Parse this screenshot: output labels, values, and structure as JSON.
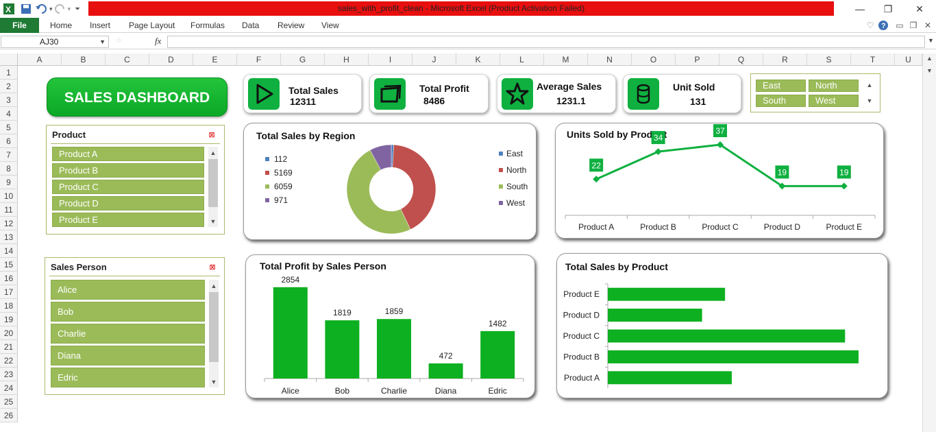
{
  "window": {
    "title": "sales_with_profit_clean  -  Microsoft Excel (Product Activation Failed)"
  },
  "ribbon": {
    "file": "File",
    "tabs": [
      "Home",
      "Insert",
      "Page Layout",
      "Formulas",
      "Data",
      "Review",
      "View"
    ]
  },
  "formula_bar": {
    "name_box": "AJ30",
    "fx_label": "fx",
    "formula": ""
  },
  "columns": [
    "A",
    "B",
    "C",
    "D",
    "E",
    "F",
    "G",
    "H",
    "I",
    "J",
    "K",
    "L",
    "M",
    "N",
    "O",
    "P",
    "Q",
    "R",
    "S",
    "T",
    "U"
  ],
  "rows": [
    "1",
    "2",
    "3",
    "4",
    "5",
    "6",
    "7",
    "8",
    "9",
    "10",
    "11",
    "12",
    "13",
    "14",
    "15",
    "16",
    "17",
    "18",
    "19",
    "20",
    "21",
    "22",
    "23",
    "24",
    "25",
    "26"
  ],
  "dashboard": {
    "title": "SALES DASHBOARD",
    "kpis": [
      {
        "label": "Total Sales",
        "value": "12311",
        "icon": "play-icon"
      },
      {
        "label": "Total Profit",
        "value": "8486",
        "icon": "folder-icon"
      },
      {
        "label": "Average Sales",
        "value": "1231.1",
        "icon": "star-icon"
      },
      {
        "label": "Unit Sold",
        "value": "131",
        "icon": "database-icon"
      }
    ],
    "region_slicer": {
      "items": [
        "East",
        "North",
        "South",
        "West"
      ]
    },
    "product_slicer": {
      "title": "Product",
      "items": [
        "Product A",
        "Product B",
        "Product C",
        "Product D",
        "Product E"
      ]
    },
    "salesperson_slicer": {
      "title": "Sales Person",
      "items": [
        "Alice",
        "Bob",
        "Charlie",
        "Diana",
        "Edric"
      ]
    }
  },
  "colors": {
    "accent_green": "#0fb040",
    "slicer_green": "#9bbb59",
    "east": "#4f81bd",
    "north": "#c0504d",
    "south": "#9bbb59",
    "west": "#8064a2",
    "bar_green": "#0db020"
  },
  "chart_data": [
    {
      "type": "pie",
      "title": "Total Sales by Region",
      "categories": [
        "East",
        "North",
        "South",
        "West"
      ],
      "values": [
        112,
        5169,
        6059,
        971
      ],
      "labels": [
        "112",
        "5169",
        "6059",
        "971"
      ]
    },
    {
      "type": "line",
      "title": "Units Sold by Product",
      "categories": [
        "Product A",
        "Product B",
        "Product C",
        "Product D",
        "Product E"
      ],
      "values": [
        22,
        34,
        37,
        19,
        19
      ]
    },
    {
      "type": "bar",
      "title": "Total Profit by Sales Person",
      "categories": [
        "Alice",
        "Bob",
        "Charlie",
        "Diana",
        "Edric"
      ],
      "values": [
        2854,
        1819,
        1859,
        472,
        1482
      ]
    },
    {
      "type": "bar",
      "orientation": "horizontal",
      "title": "Total Sales by Product",
      "categories": [
        "Product A",
        "Product B",
        "Product C",
        "Product D",
        "Product E"
      ],
      "values": [
        3130,
        6330,
        5990,
        2380,
        2960
      ]
    }
  ]
}
